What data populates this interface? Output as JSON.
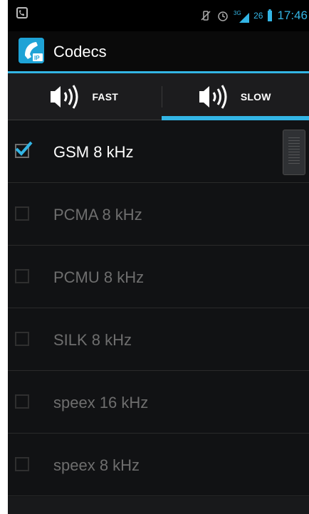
{
  "status_bar": {
    "battery_level": "26",
    "signal_type": "3G",
    "time": "17:46",
    "icons": [
      "notification-app-icon",
      "vibrate-icon",
      "alarm-icon",
      "signal-3g-icon",
      "battery-icon"
    ]
  },
  "action_bar": {
    "title": "Codecs",
    "app_icon": "phone-ip-icon"
  },
  "tabs": [
    {
      "label": "FAST",
      "icon": "speaker-icon",
      "selected": false
    },
    {
      "label": "SLOW",
      "icon": "speaker-icon",
      "selected": true
    }
  ],
  "codecs": [
    {
      "label": "GSM 8 kHz",
      "checked": true
    },
    {
      "label": "PCMA 8 kHz",
      "checked": false
    },
    {
      "label": "PCMU 8 kHz",
      "checked": false
    },
    {
      "label": "SILK 8 kHz",
      "checked": false
    },
    {
      "label": "speex 16 kHz",
      "checked": false
    },
    {
      "label": "speex 8 kHz",
      "checked": false
    }
  ],
  "colors": {
    "accent": "#33b5e5",
    "background": "#111214",
    "text_checked": "#ffffff",
    "text_unchecked": "#6e6e6e"
  }
}
